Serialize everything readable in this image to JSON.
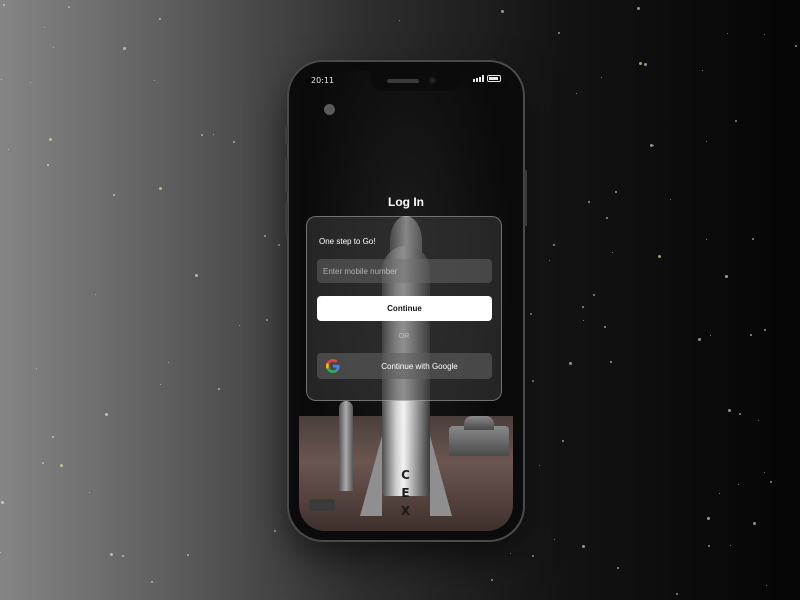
{
  "status_bar": {
    "time": "20:11"
  },
  "login": {
    "title": "Log In",
    "subtitle": "One step to Go!",
    "mobile_placeholder": "Enter mobile number",
    "continue_label": "Continue",
    "divider_label": "OR",
    "google_label": "Continue with Google"
  },
  "rocket": {
    "letters": [
      "C",
      "E",
      "X"
    ]
  },
  "icons": {
    "google": "google-g-icon",
    "status": [
      "whatsapp-icon",
      "signal-icon",
      "battery-icon"
    ]
  },
  "colors": {
    "primary_button": "#ffffff",
    "card_border": "rgba(255,255,255,0.35)",
    "background_dark": "#050505"
  }
}
